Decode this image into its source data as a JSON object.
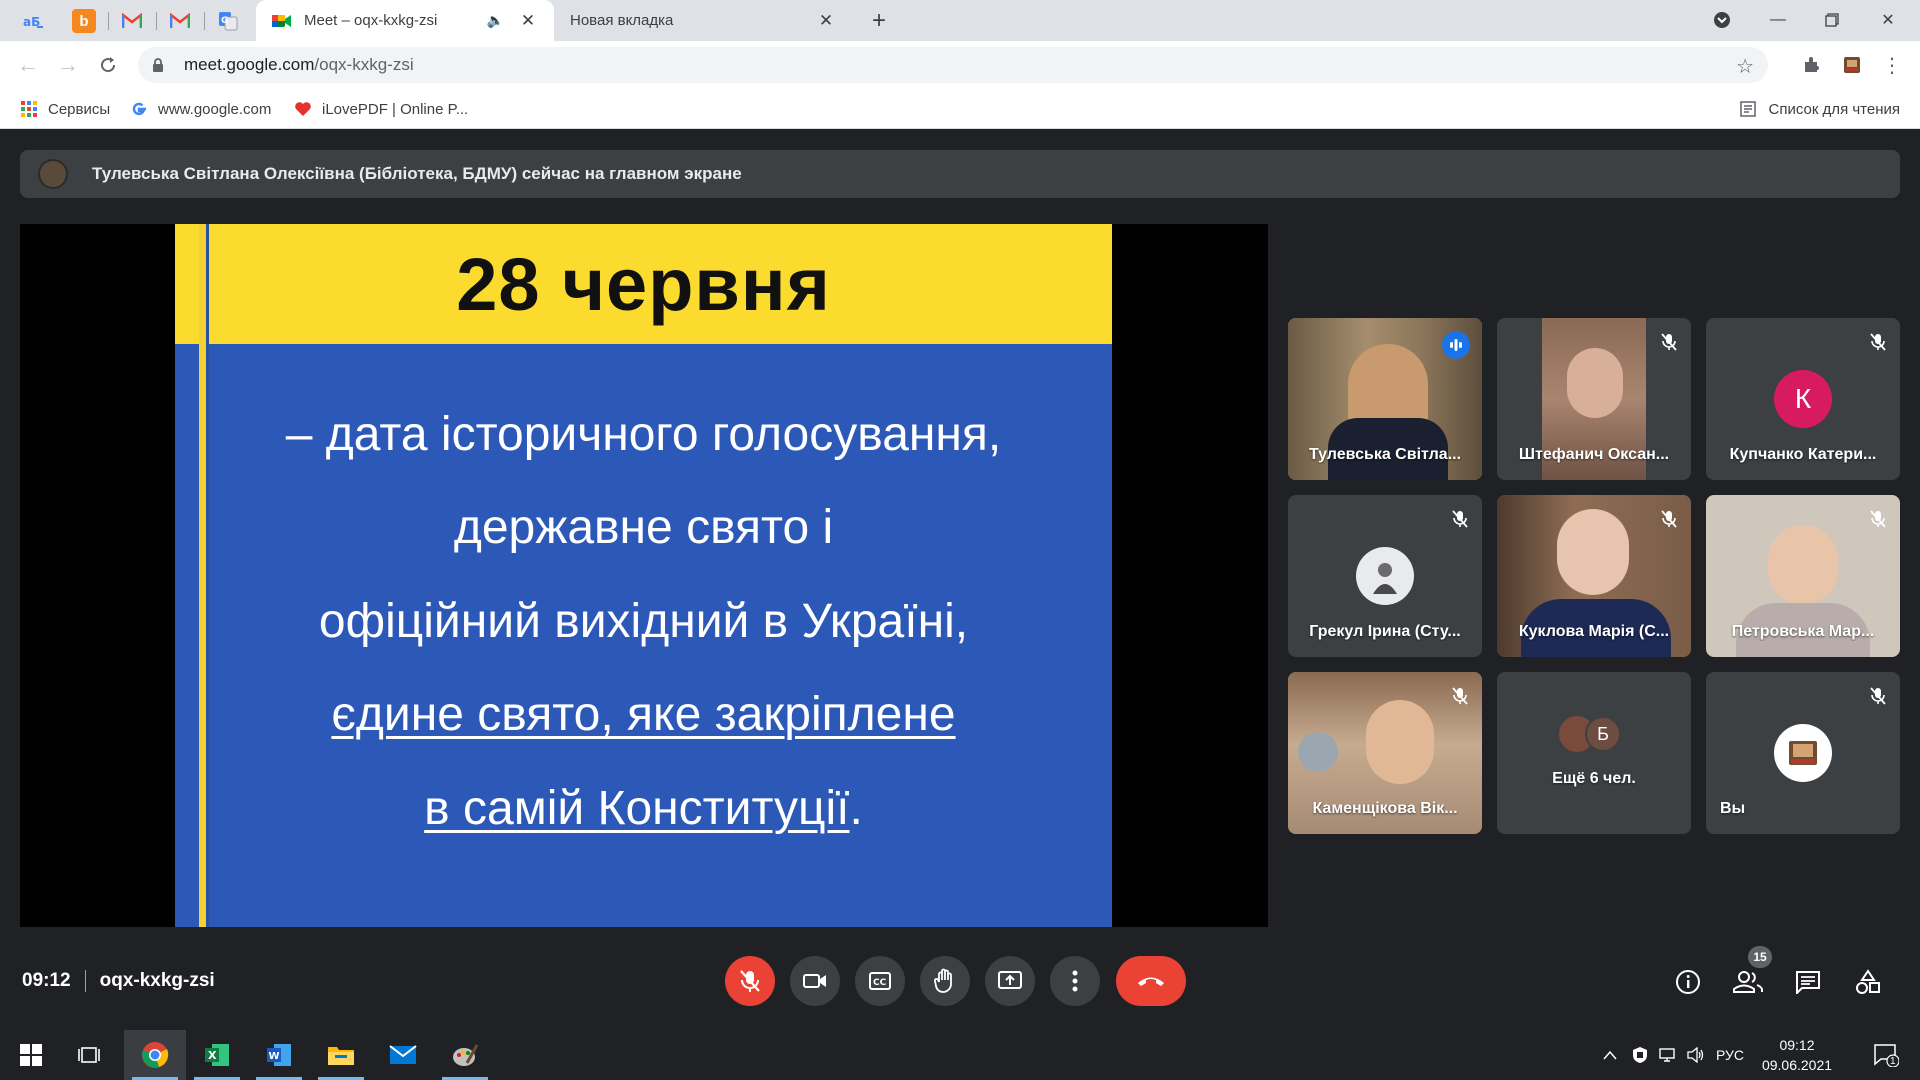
{
  "browser": {
    "tabs": [
      {
        "title": "Meet – oqx-kxkg-zsi",
        "active": true
      },
      {
        "title": "Новая вкладка",
        "active": false
      }
    ],
    "url_host": "meet.google.com",
    "url_path": "/oqx-kxkg-zsi",
    "bookmarks": [
      {
        "label": "Сервисы",
        "icon": "apps-grid-icon"
      },
      {
        "label": "www.google.com",
        "icon": "google-g-icon"
      },
      {
        "label": "iLovePDF | Online P...",
        "icon": "ilovepdf-heart-icon"
      }
    ],
    "reading_list": "Список для чтения"
  },
  "meet": {
    "presenter_banner": "Тулевська Світлана Олексіївна (Бібліотека, БДМУ) сейчас на главном экране",
    "slide": {
      "heading": "28 червня",
      "line1": "– дата історичного голосування,",
      "line2": "державне свято і",
      "line3": "офіційний вихідний в Україні,",
      "line4": "єдине свято, яке закріплене",
      "line5_underlined": "в самій Конституції",
      "line5_tail": "."
    },
    "participants": [
      {
        "name": "Тулевська Світла...",
        "muted": false,
        "speaking": true
      },
      {
        "name": "Штефанич Оксан...",
        "muted": true
      },
      {
        "name": "Купчанко Катери...",
        "muted": true,
        "initial": "К"
      },
      {
        "name": "Грекул Ірина (Сту...",
        "muted": true
      },
      {
        "name": "Куклова Марія (С...",
        "muted": true
      },
      {
        "name": "Петровська Мар...",
        "muted": true
      },
      {
        "name": "Каменщікова Вік...",
        "muted": true
      },
      {
        "name": "Ещё 6 чел.",
        "muted": false,
        "initial": "Б"
      },
      {
        "name": "Вы",
        "muted": true
      }
    ],
    "time": "09:12",
    "meeting_code": "oqx-kxkg-zsi",
    "participant_count": "15"
  },
  "taskbar": {
    "language": "РУС",
    "time": "09:12",
    "date": "09.06.2021",
    "notifications": "1"
  },
  "colors": {
    "meet_bg": "#202124",
    "tile_bg": "#3c4043",
    "red": "#ea4335",
    "slide_blue": "#2c58b8",
    "slide_yellow": "#fbdb2e",
    "active_outline": "#8ab4f8"
  }
}
